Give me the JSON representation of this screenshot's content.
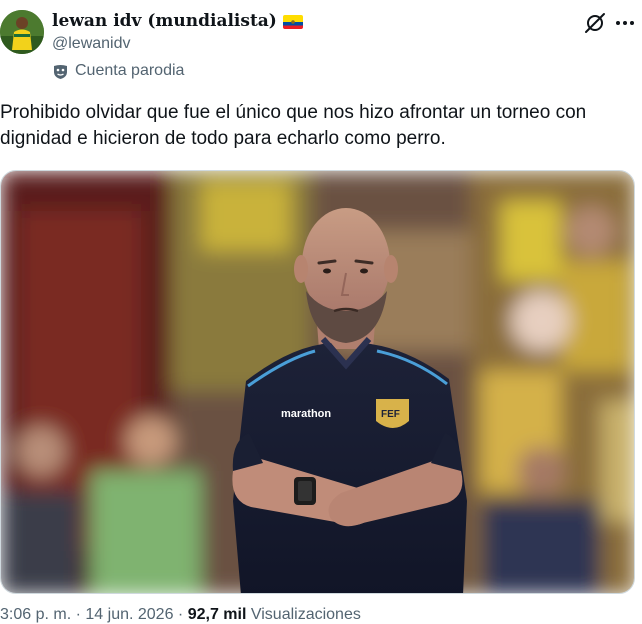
{
  "author": {
    "display_name": "lewan idv (mundialista)",
    "handle": "@lewanidv",
    "parody_label": "Cuenta parodia",
    "flag": "ecuador-flag"
  },
  "actions": {
    "grok_icon": "grok-icon",
    "more_icon": "more-icon"
  },
  "tweet": {
    "text": "Prohibido olvidar que fue el único que nos hizo afrontar un torneo con dignidad e hicieron de todo para echarlo como perro."
  },
  "media": {
    "description_icon": "photo",
    "shirt_text": "marathon",
    "crest_text": "FEF"
  },
  "meta": {
    "time": "3:06 p. m.",
    "date": "14 jun. 2026",
    "views_count": "92,7 mil",
    "views_label": "Visualizaciones"
  },
  "colors": {
    "text_primary": "#0f1419",
    "text_secondary": "#536471",
    "border": "#cfd9de",
    "flag_yellow": "#ffdd00",
    "flag_blue": "#034ea2",
    "flag_red": "#ed1c24"
  }
}
